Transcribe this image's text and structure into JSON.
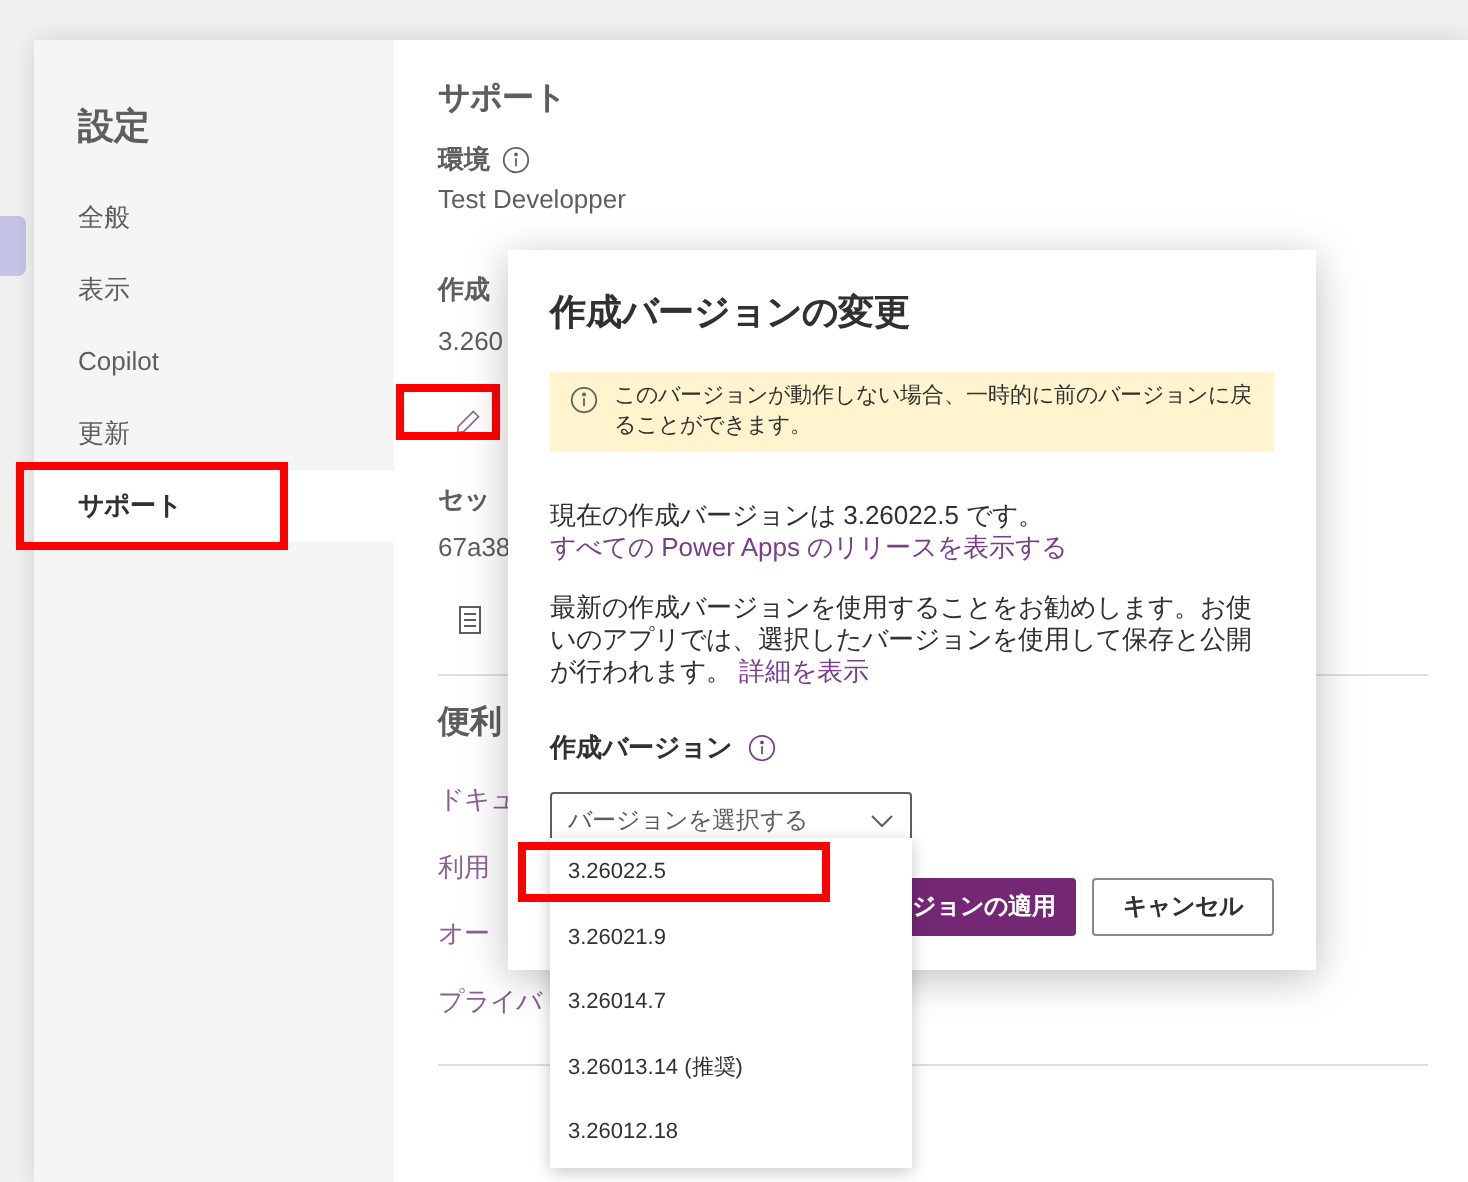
{
  "settings": {
    "title": "設定",
    "nav": [
      {
        "label": "全般",
        "selected": false,
        "highlighted": false
      },
      {
        "label": "表示",
        "selected": false,
        "highlighted": false
      },
      {
        "label": "Copilot",
        "selected": false,
        "highlighted": false
      },
      {
        "label": "更新",
        "selected": false,
        "highlighted": false
      },
      {
        "label": "サポート",
        "selected": true,
        "highlighted": true
      }
    ]
  },
  "support": {
    "heading": "サポート",
    "environment_label": "環境",
    "environment_value": "Test Developper",
    "version_label": "作成",
    "version_value": "3.260",
    "edit_highlighted": true,
    "session_label": "セッ",
    "session_value": "67a38",
    "useful_heading": "便利",
    "links": [
      "ドキュ",
      "利用",
      "オー",
      "プライバ"
    ]
  },
  "dialog": {
    "title": "作成バージョンの変更",
    "notice": "このバージョンが動作しない場合、一時的に前のバージョンに戻ることができます。",
    "current_text": "現在の作成バージョンは 3.26022.5 です。",
    "current_link": "すべての Power Apps のリリースを表示する",
    "recommend_text": "最新の作成バージョンを使用することをお勧めします。お使いのアプリでは、選択したバージョンを使用して保存と公開が行われます。",
    "recommend_link": "詳細を表示",
    "field_label": "作成バージョン",
    "select": {
      "placeholder": "バージョンを選択する",
      "expanded": true
    },
    "apply_button": "ジョンの適用",
    "cancel_button": "キャンセル"
  },
  "options": [
    {
      "label": "3.26022.5",
      "highlighted": true
    },
    {
      "label": "3.26021.9",
      "highlighted": false
    },
    {
      "label": "3.26014.7",
      "highlighted": false
    },
    {
      "label": "3.26013.14 (推奨)",
      "highlighted": false
    },
    {
      "label": "3.26012.18",
      "highlighted": false
    }
  ]
}
